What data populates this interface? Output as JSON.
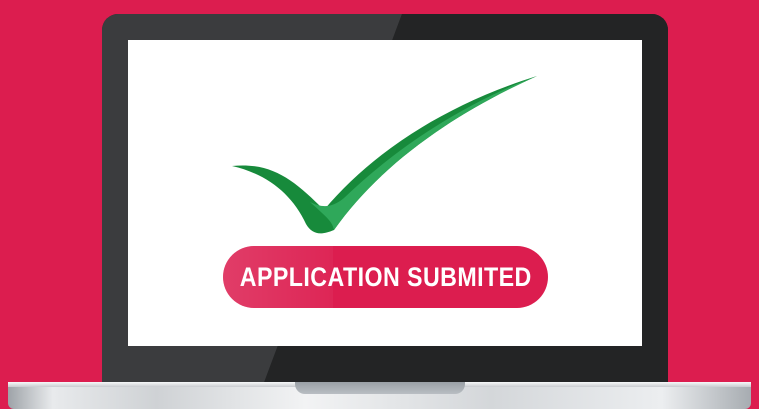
{
  "colors": {
    "background": "#dc1d4f",
    "lid": "#262728",
    "screen": "#ffffff",
    "check_dark": "#178a3b",
    "check_light": "#2fa85a",
    "pill": "#dc1d4f",
    "pill_text": "#ffffff"
  },
  "screen": {
    "status_label": "APPLICATION SUBMITED"
  },
  "icons": {
    "main": "checkmark-icon"
  }
}
